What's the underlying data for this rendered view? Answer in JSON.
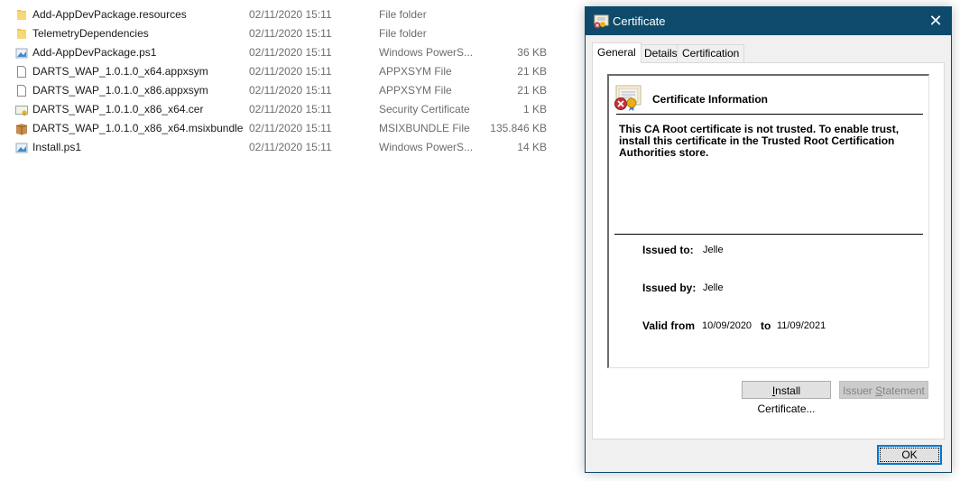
{
  "file_list": {
    "rows": [
      {
        "name": "Add-AppDevPackage.resources",
        "date": "02/11/2020 15:11",
        "type": "File folder",
        "size": "",
        "icon": "folder-icon"
      },
      {
        "name": "TelemetryDependencies",
        "date": "02/11/2020 15:11",
        "type": "File folder",
        "size": "",
        "icon": "folder-icon"
      },
      {
        "name": "Add-AppDevPackage.ps1",
        "date": "02/11/2020 15:11",
        "type": "Windows PowerS...",
        "size": "36 KB",
        "icon": "powershell-script-icon"
      },
      {
        "name": "DARTS_WAP_1.0.1.0_x64.appxsym",
        "date": "02/11/2020 15:11",
        "type": "APPXSYM File",
        "size": "21 KB",
        "icon": "blank-file-icon"
      },
      {
        "name": "DARTS_WAP_1.0.1.0_x86.appxsym",
        "date": "02/11/2020 15:11",
        "type": "APPXSYM File",
        "size": "21 KB",
        "icon": "blank-file-icon"
      },
      {
        "name": "DARTS_WAP_1.0.1.0_x86_x64.cer",
        "date": "02/11/2020 15:11",
        "type": "Security Certificate",
        "size": "1 KB",
        "icon": "certificate-file-icon"
      },
      {
        "name": "DARTS_WAP_1.0.1.0_x86_x64.msixbundle",
        "date": "02/11/2020 15:11",
        "type": "MSIXBUNDLE File",
        "size": "135.846 KB",
        "icon": "package-icon"
      },
      {
        "name": "Install.ps1",
        "date": "02/11/2020 15:11",
        "type": "Windows PowerS...",
        "size": "14 KB",
        "icon": "powershell-script-icon"
      }
    ]
  },
  "dialog": {
    "title": "Certificate",
    "close_glyph": "✕",
    "tabs": [
      {
        "label": "General",
        "active": true
      },
      {
        "label": "Details",
        "active": false
      },
      {
        "label": "Certification Path",
        "active": false
      }
    ],
    "info": {
      "heading": "Certificate Information",
      "warning": "This CA Root certificate is not trusted. To enable trust, install this certificate in the Trusted Root Certification Authorities store.",
      "issued_to_label": "Issued to:",
      "issued_to": "Jelle",
      "issued_by_label": "Issued by:",
      "issued_by": "Jelle",
      "valid_from_label": "Valid from",
      "valid_from": "10/09/2020",
      "to_label": "to",
      "valid_to": "11/09/2021"
    },
    "buttons": {
      "install_first": "I",
      "install_rest": "nstall Certificate...",
      "issuer_pre": "Issuer ",
      "issuer_accel": "S",
      "issuer_rest": "tatement",
      "ok": "OK"
    }
  }
}
